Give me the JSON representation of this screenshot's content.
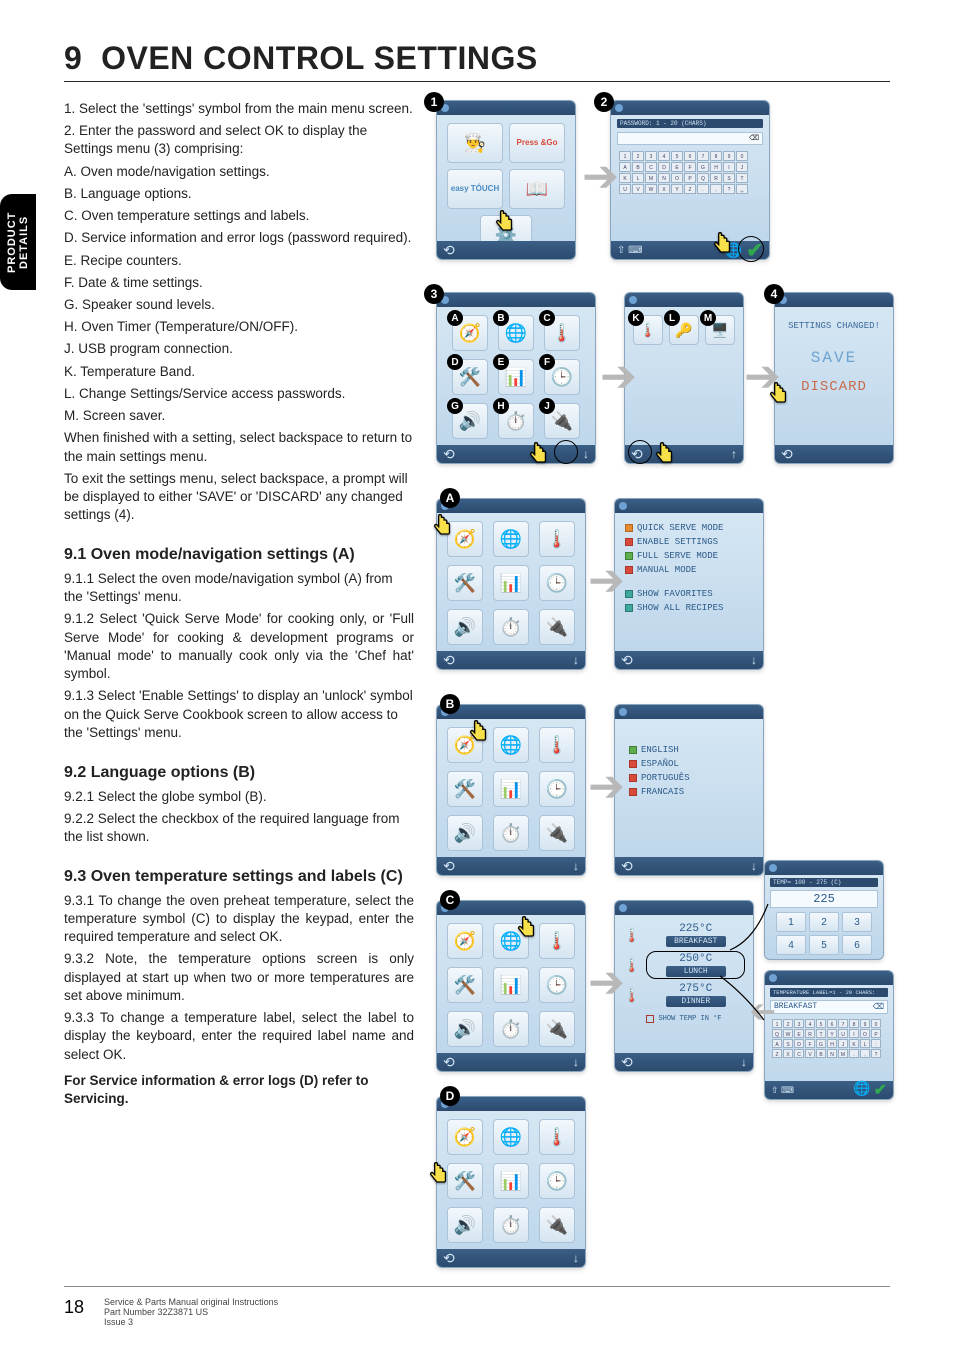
{
  "chapter": {
    "number": "9",
    "title": "OVEN CONTROL SETTINGS"
  },
  "side_tab": "PRODUCT DETAILS",
  "intro": [
    "1. Select the 'settings' symbol from the main menu screen.",
    "2. Enter the password and select OK to display the Settings menu (3) comprising:",
    "A. Oven mode/navigation settings.",
    "B. Language options.",
    "C. Oven temperature settings and labels.",
    "D. Service information and error logs (password required).",
    "E. Recipe counters.",
    "F. Date & time settings.",
    "G. Speaker sound levels.",
    "H. Oven Timer (Temperature/ON/OFF).",
    "J. USB program connection.",
    "K. Temperature Band.",
    "L. Change Settings/Service access passwords.",
    "M. Screen saver.",
    "When finished with a setting, select backspace to return to the main settings menu.",
    "To exit the settings menu, select backspace, a prompt will be displayed to either 'SAVE' or 'DISCARD' any changed settings (4)."
  ],
  "sections": {
    "s91": {
      "heading": "9.1  Oven mode/navigation settings (A)",
      "p": [
        "9.1.1  Select the oven mode/navigation symbol (A) from the 'Settings' menu.",
        "9.1.2  Select 'Quick Serve Mode' for cooking only, or 'Full Serve Mode' for cooking & development programs or 'Manual mode' to manually cook only via the 'Chef hat' symbol.",
        "9.1.3  Select 'Enable Settings' to display an 'unlock' symbol on the Quick Serve Cookbook screen to allow access to the 'Settings' menu."
      ]
    },
    "s92": {
      "heading": "9.2  Language options (B)",
      "p": [
        "9.2.1  Select the globe symbol (B).",
        "9.2.2  Select the checkbox of the required language from the list shown."
      ]
    },
    "s93": {
      "heading": "9.3  Oven temperature settings and labels (C)",
      "p": [
        "9.3.1  To change the oven preheat temperature, select the temperature symbol (C) to display the keypad, enter the required temperature and select OK.",
        "9.3.2  Note, the temperature options screen is only displayed at start up when two or more temperatures are set above minimum.",
        "9.3.3  To change a temperature label, select the label to display the keyboard, enter the required label name and select OK."
      ],
      "note": "For Service information & error logs (D) refer to Servicing."
    }
  },
  "figures": {
    "markers": [
      "1",
      "2",
      "3",
      "4"
    ],
    "letters": [
      "A",
      "B",
      "C",
      "D",
      "E",
      "F",
      "G",
      "H",
      "J",
      "K",
      "L",
      "M"
    ],
    "main_menu": {
      "press_go": "Press &Go",
      "easy_touch": "easy TÓUCH"
    },
    "password_hint": "PASSWORD: 1 - 20 (CHARS)",
    "save_screen": {
      "title": "SETTINGS CHANGED!",
      "save": "SAVE",
      "discard": "DISCARD"
    },
    "mode_list": {
      "items": [
        {
          "cb": "orange",
          "label": "QUICK SERVE MODE"
        },
        {
          "cb": "red",
          "label": "ENABLE SETTINGS"
        },
        {
          "cb": "green",
          "label": "FULL SERVE MODE"
        },
        {
          "cb": "red",
          "label": "MANUAL MODE"
        }
      ],
      "extra": [
        {
          "cb": "teal",
          "label": "SHOW FAVORITES"
        },
        {
          "cb": "teal",
          "label": "SHOW ALL RECIPES"
        }
      ]
    },
    "lang_list": [
      {
        "cb": "green",
        "label": "ENGLISH"
      },
      {
        "cb": "red",
        "label": "ESPAÑOL"
      },
      {
        "cb": "red",
        "label": "PORTUGUÊS"
      },
      {
        "cb": "red",
        "label": "FRANCAIS"
      }
    ],
    "temp_panel": {
      "items": [
        {
          "val": "225°C",
          "label": "BREAKFAST"
        },
        {
          "val": "250°C",
          "label": "LUNCH"
        },
        {
          "val": "275°C",
          "label": "DINNER"
        }
      ],
      "footer": "SHOW TEMP IN °F"
    },
    "temp_keypad": {
      "hint": "TEMP= 100 - 275 (C)",
      "display": "225",
      "keys": [
        "1",
        "2",
        "3",
        "4",
        "5",
        "6"
      ]
    },
    "label_keypad": {
      "hint": "TEMPERATURE LABEL=1 - 20 CHARS:",
      "display": "BREAKFAST"
    }
  },
  "footer": {
    "page": "18",
    "lines": [
      "Service & Parts Manual original Instructions",
      "Part Number 32Z3871 US",
      "Issue 3"
    ]
  }
}
